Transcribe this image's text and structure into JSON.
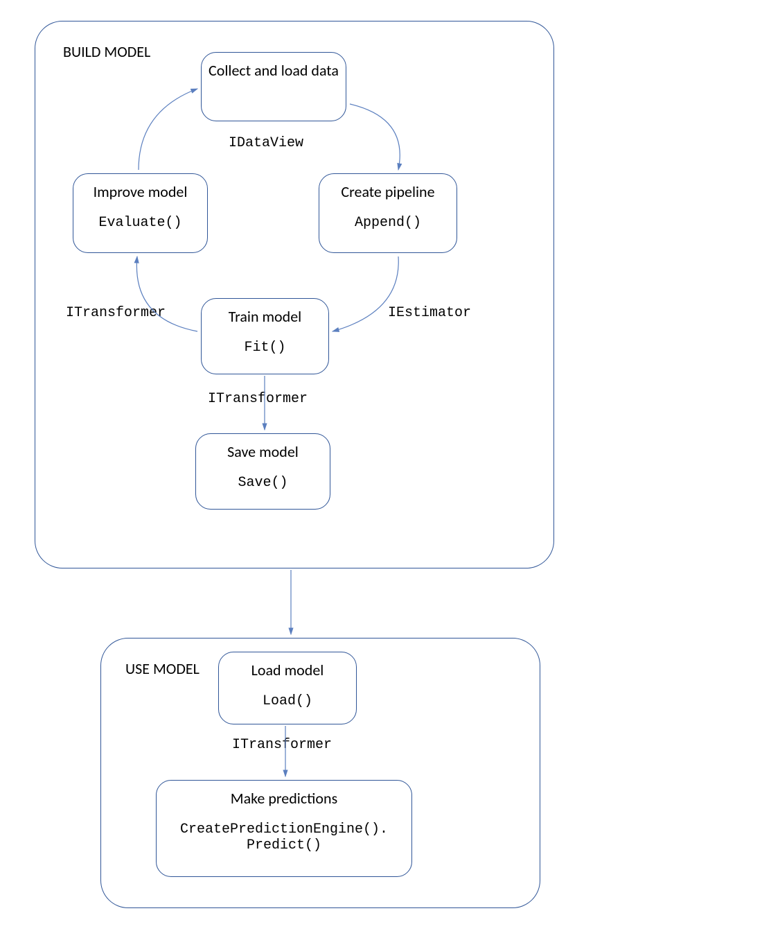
{
  "build": {
    "label": "BUILD MODEL",
    "collect": {
      "title": "Collect and load data"
    },
    "improve": {
      "title": "Improve model",
      "method": "Evaluate()"
    },
    "pipeline": {
      "title": "Create pipeline",
      "method": "Append()"
    },
    "train": {
      "title": "Train model",
      "method": "Fit()"
    },
    "save": {
      "title": "Save model",
      "method": "Save()"
    },
    "edges": {
      "idataview": "IDataView",
      "iestimator": "IEstimator",
      "itransformer_left": "ITransformer",
      "itransformer_down": "ITransformer"
    }
  },
  "use": {
    "label": "USE MODEL",
    "load": {
      "title": "Load model",
      "method": "Load()"
    },
    "predict": {
      "title": "Make predictions",
      "method": "CreatePredictionEngine().\nPredict()"
    },
    "edges": {
      "itransformer": "ITransformer"
    }
  }
}
